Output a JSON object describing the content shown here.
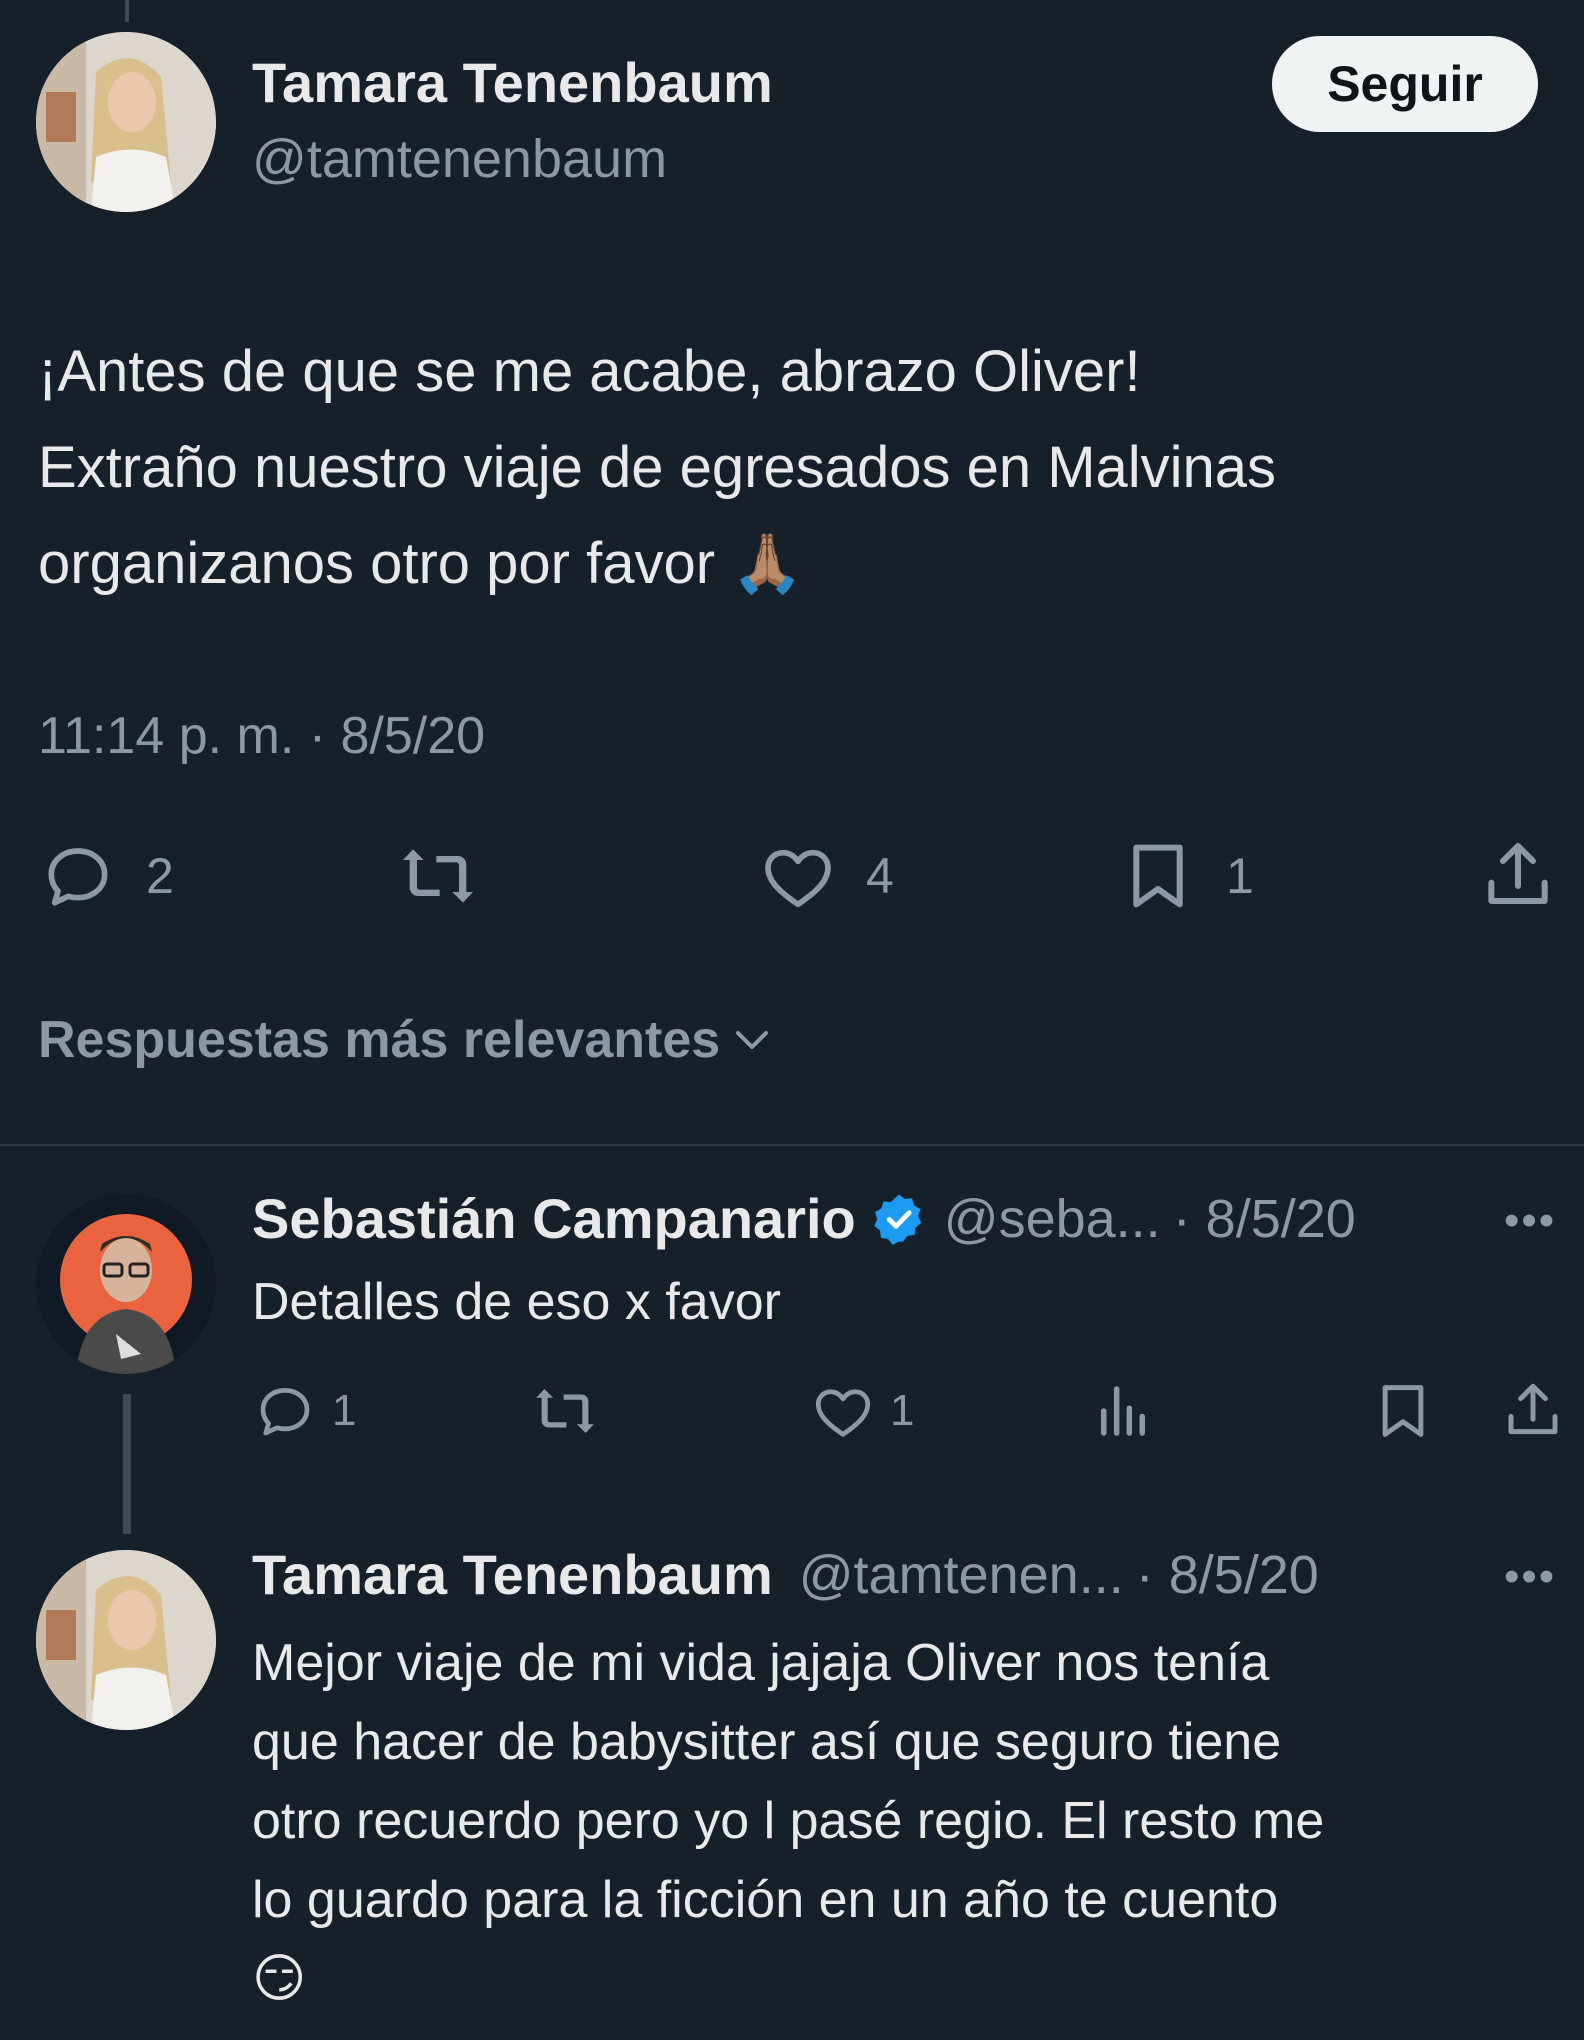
{
  "tweet": {
    "author": {
      "name": "Tamara Tenenbaum",
      "handle": "@tamtenenbaum",
      "avatar": "woman-blonde-avatar"
    },
    "follow_label": "Seguir",
    "text_lines": [
      "¡Antes de que se me acabe, abrazo Oliver!",
      "Extraño nuestro viaje de egresados en Malvinas",
      "organizanos otro por favor 🙏🏽"
    ],
    "timestamp": "11:14 p. m. · 8/5/20",
    "actions": {
      "replies": "2",
      "retweets": "",
      "likes": "4",
      "bookmarks": "1"
    }
  },
  "sort_label": "Respuestas más relevantes",
  "replies": [
    {
      "name": "Sebastián Campanario",
      "verified": true,
      "handle": "@seba...",
      "date": "· 8/5/20",
      "text": "Detalles de eso x favor",
      "avatar": "man-glasses-avatar",
      "actions": {
        "replies": "1",
        "retweets": "",
        "likes": "1"
      }
    },
    {
      "name": "Tamara Tenenbaum",
      "handle": "@tamtenen...",
      "date": "· 8/5/20",
      "avatar": "woman-blonde-avatar",
      "text_lines": [
        "Mejor viaje de mi vida jajaja Oliver nos tenía",
        "que hacer de babysitter así que seguro tiene",
        "otro recuerdo pero yo l pasé regio. El resto me",
        "lo guardo para la ficción en un año te cuento",
        "😏"
      ]
    }
  ],
  "more_label": "•••",
  "colors": {
    "background": "#15202b",
    "text": "#e7e9ea",
    "secondary": "#8b98a5",
    "verified": "#1d9bf0",
    "button_bg": "#eff3f4"
  }
}
